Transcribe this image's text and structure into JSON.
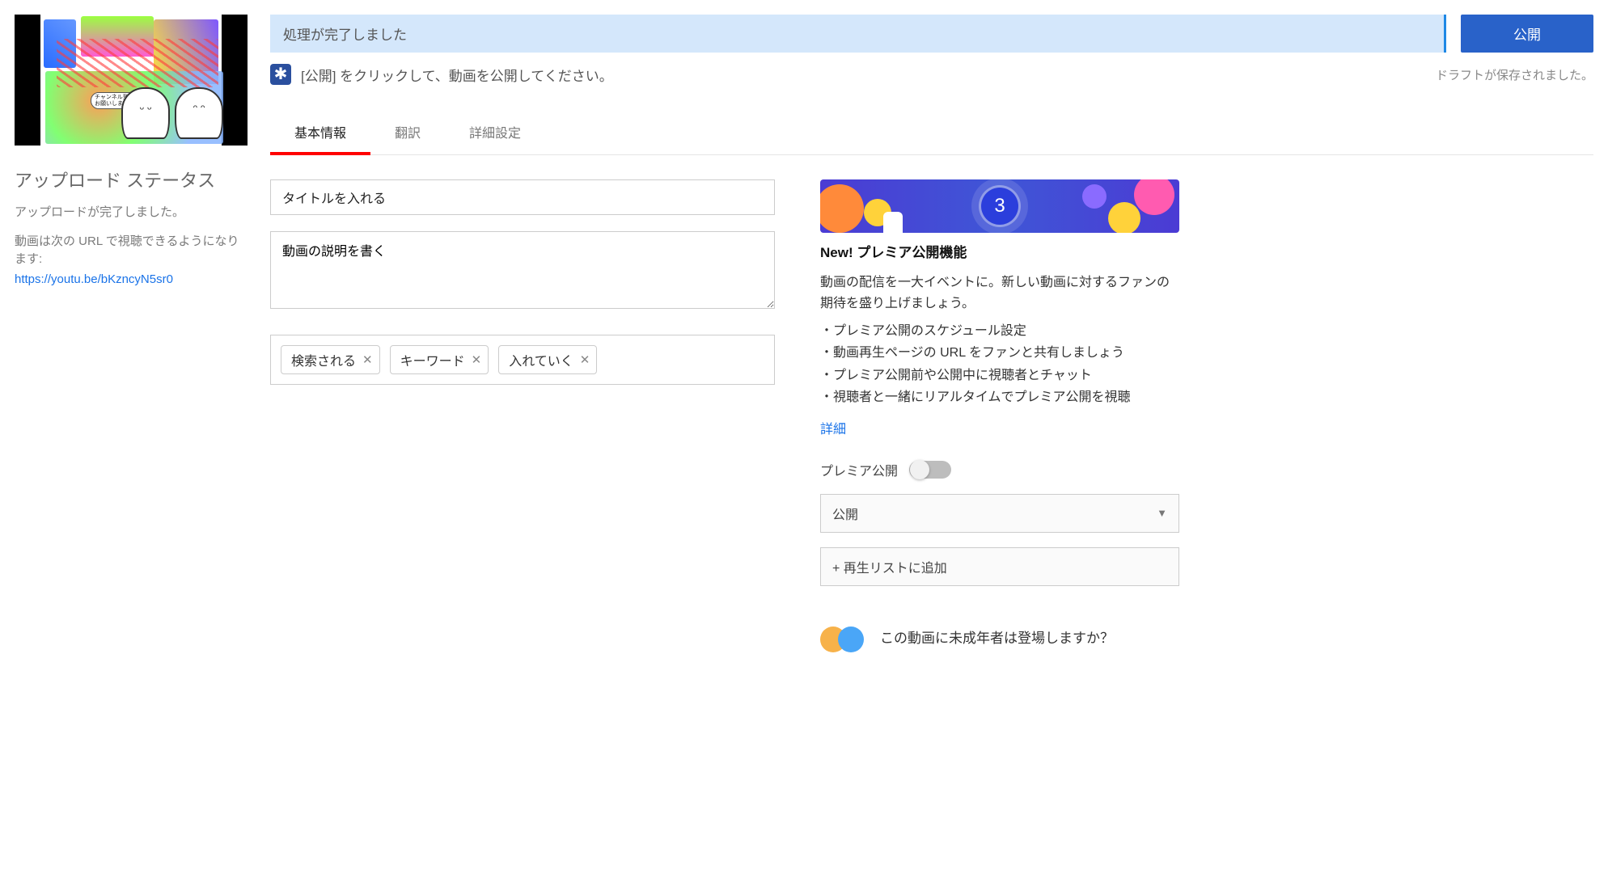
{
  "left": {
    "upload_status_heading": "アップロード ステータス",
    "upload_done": "アップロードが完了しました。",
    "url_intro": "動画は次の URL で視聴できるようになります:",
    "video_url": "https://youtu.be/bKzncyN5sr0"
  },
  "topbar": {
    "processing_done": "処理が完了しました",
    "publish_button": "公開",
    "hint": "[公開] をクリックして、動画を公開してください。",
    "draft_saved": "ドラフトが保存されました。",
    "hint_badge": "✱"
  },
  "tabs": {
    "basic": "基本情報",
    "translation": "翻訳",
    "advanced": "詳細設定"
  },
  "form": {
    "title_value": "タイトルを入れる",
    "description_value": "動画の説明を書く",
    "tags": [
      "検索される",
      "キーワード",
      "入れていく"
    ]
  },
  "promo": {
    "countdown": "3",
    "title": "New! プレミア公開機能",
    "lede": "動画の配信を一大イベントに。新しい動画に対するファンの期待を盛り上げましょう。",
    "bullets": [
      "・プレミア公開のスケジュール設定",
      "・動画再生ページの URL をファンと共有しましょう",
      "・プレミア公開前や公開中に視聴者とチャット",
      "・視聴者と一緒にリアルタイムでプレミア公開を視聴"
    ],
    "details": "詳細",
    "premiere_toggle_label": "プレミア公開",
    "visibility": "公開",
    "add_playlist": "+ 再生リストに追加",
    "minors_question": "この動画に未成年者は登場しますか？"
  }
}
